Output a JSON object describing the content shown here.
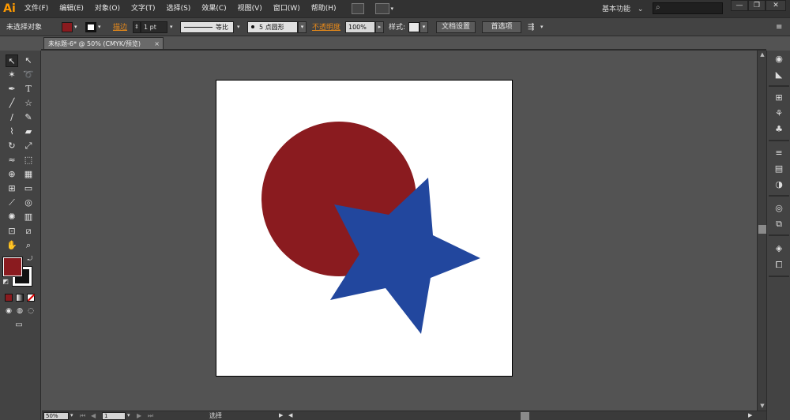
{
  "app": {
    "logo": "Ai",
    "menu": [
      "文件(F)",
      "编辑(E)",
      "对象(O)",
      "文字(T)",
      "选择(S)",
      "效果(C)",
      "视图(V)",
      "窗口(W)",
      "帮助(H)"
    ],
    "workspace": "基本功能",
    "workspace_arrow": "⌄",
    "window_buttons": [
      "—",
      "❐",
      "✕"
    ]
  },
  "control_bar": {
    "selection_status": "未选择对象",
    "fill_color": "#8a1b1f",
    "stroke_label": "描边",
    "stroke_weight": "1 pt",
    "stroke_profile": "等比",
    "brush": "5 点圆形",
    "opacity_label": "不透明度",
    "opacity_value": "100%",
    "style_label": "样式:",
    "doc_setup_button": "文档设置",
    "preferences_button": "首选项"
  },
  "document": {
    "tab_title": "未标题-6* @ 50% (CMYK/预览)",
    "tab_close": "×",
    "artboard_color": "#ffffff",
    "shapes": [
      {
        "kind": "circle",
        "color": "#8a1b1f",
        "label": "red-circle"
      },
      {
        "kind": "star",
        "color": "#22479e",
        "label": "blue-star"
      }
    ]
  },
  "status_bar": {
    "zoom": "50%",
    "artboard_number": "1",
    "tool_status": "选择"
  },
  "colors": {
    "fill": "#8a1b1f",
    "stroke": "#111111",
    "accent_orange": "#e88a1a"
  }
}
